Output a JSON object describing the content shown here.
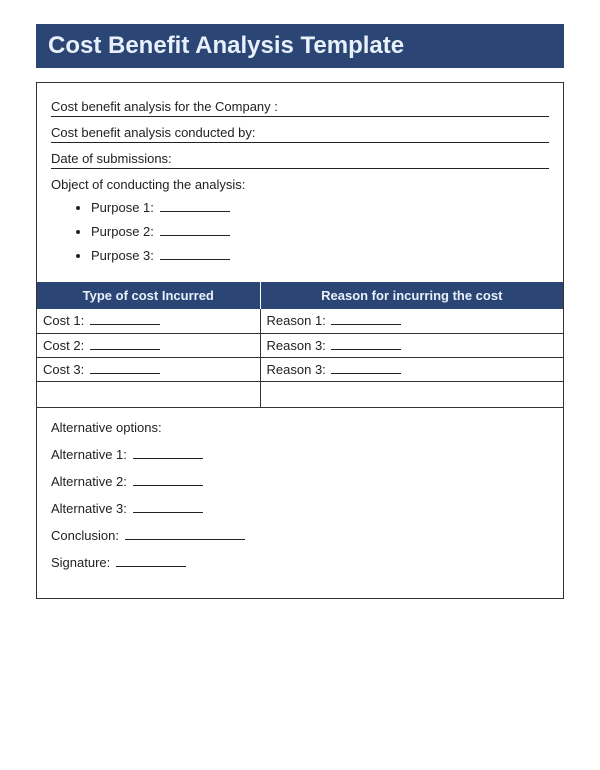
{
  "title": "Cost Benefit Analysis Template",
  "fields": {
    "company_label": "Cost benefit analysis for the Company :",
    "conducted_by_label": "Cost benefit analysis conducted  by:",
    "date_label": "Date of submissions:",
    "object_label": "Object of conducting the analysis:"
  },
  "purposes": [
    {
      "label": "Purpose 1:"
    },
    {
      "label": "Purpose 2:"
    },
    {
      "label": "Purpose 3:"
    }
  ],
  "table": {
    "header_cost": "Type of cost Incurred",
    "header_reason": "Reason for incurring the cost",
    "rows": [
      {
        "cost": "Cost 1:",
        "reason": "Reason 1:"
      },
      {
        "cost": "Cost 2:",
        "reason": "Reason 3:"
      },
      {
        "cost": "Cost 3:",
        "reason": "Reason 3:"
      }
    ]
  },
  "alternatives": {
    "heading": "Alternative options:",
    "items": [
      {
        "label": "Alternative 1:"
      },
      {
        "label": "Alternative 2:"
      },
      {
        "label": "Alternative 3:"
      }
    ],
    "conclusion": "Conclusion:",
    "signature": "Signature:"
  }
}
